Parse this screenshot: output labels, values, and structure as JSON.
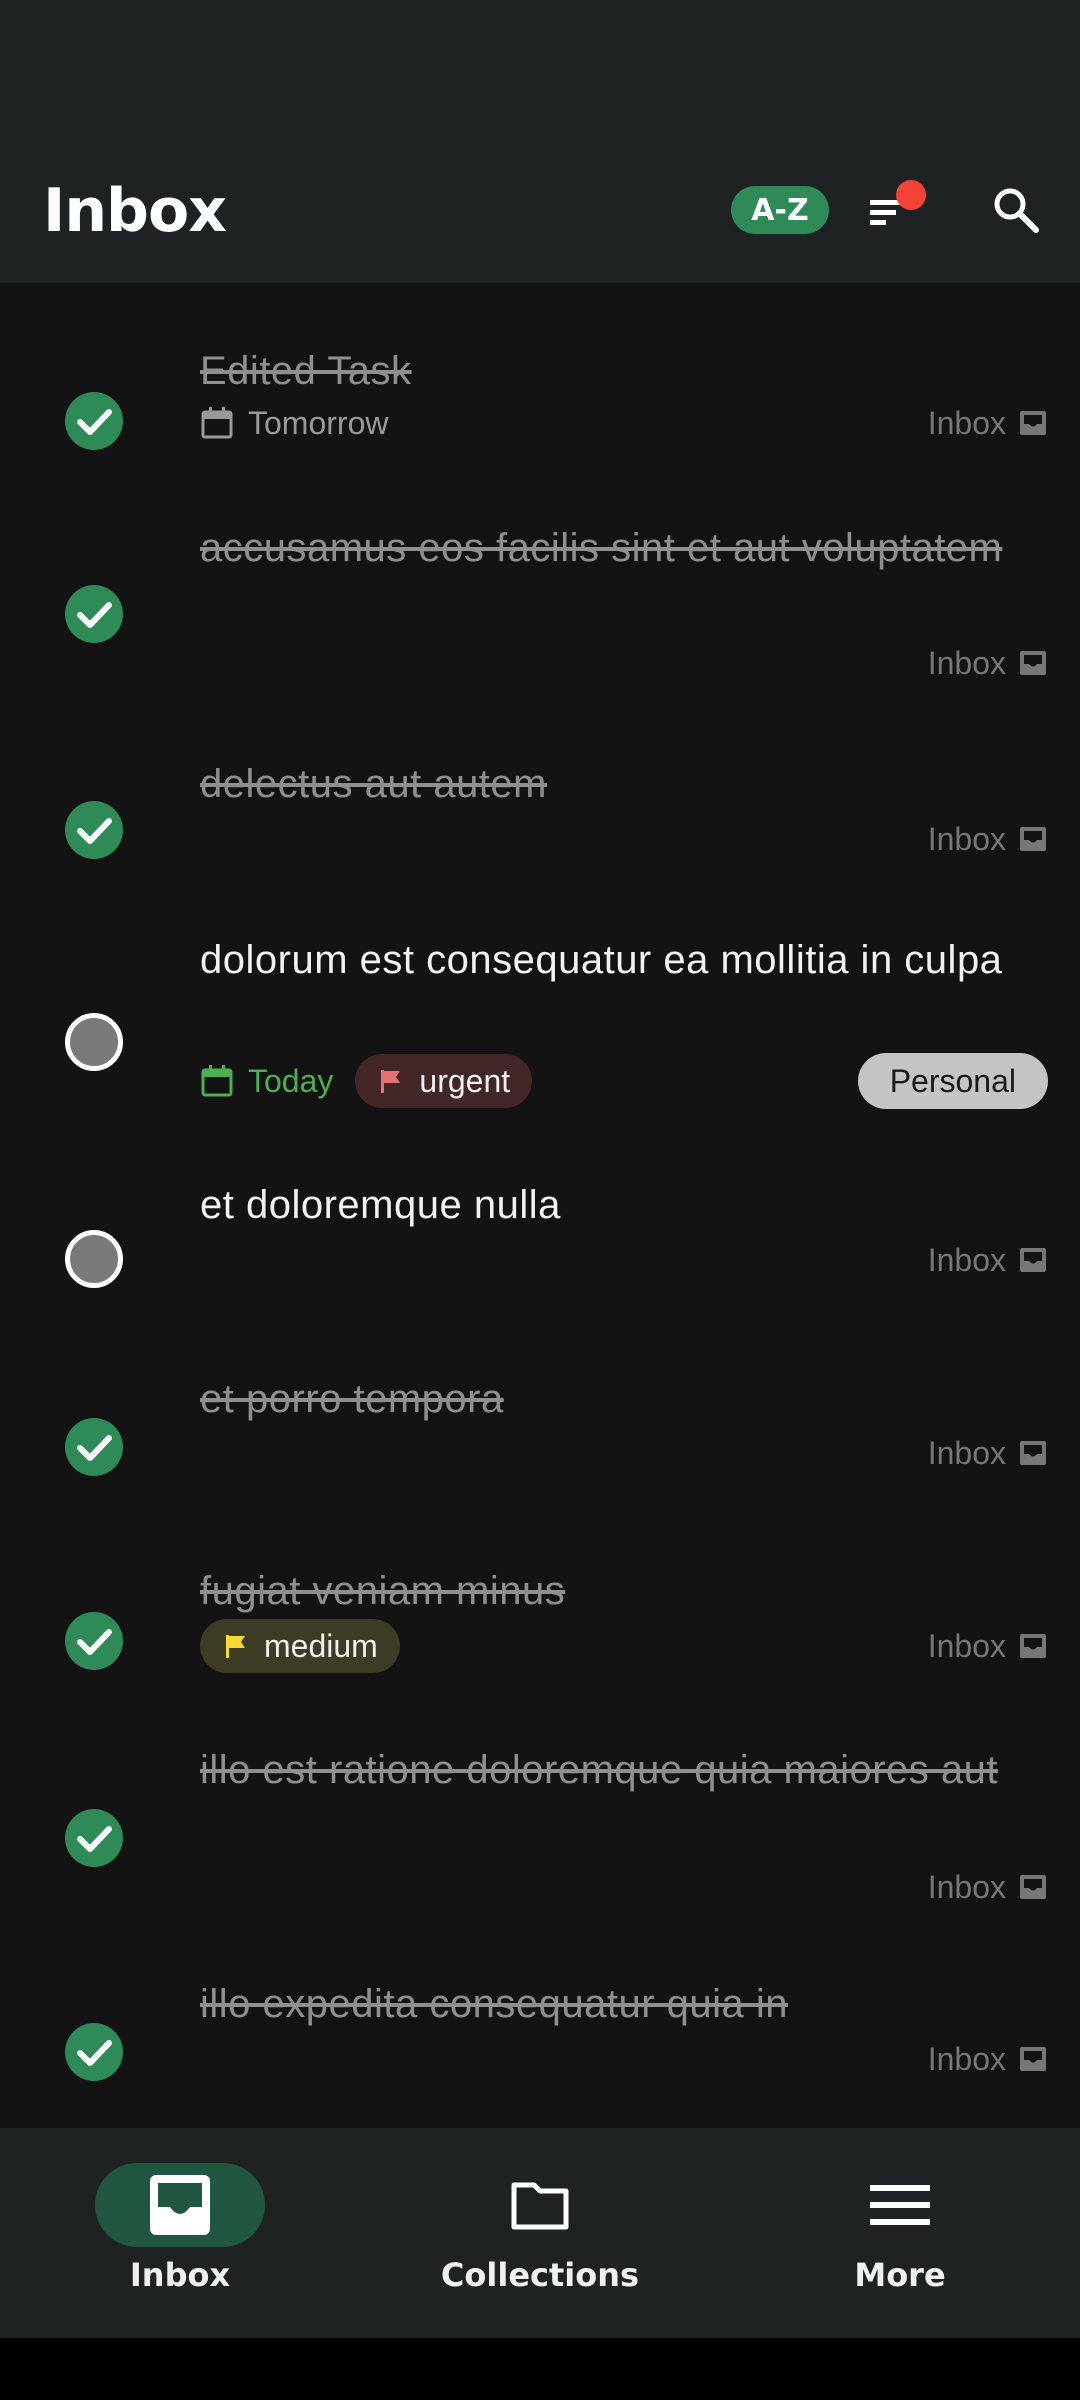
{
  "header": {
    "title": "Inbox",
    "sort_label": "A-Z",
    "filter_icon": "filter-lines-icon",
    "search_icon": "search-icon"
  },
  "tasks": [
    {
      "title": "Edited Task",
      "done": true,
      "date": "Tomorrow",
      "collection": "Inbox"
    },
    {
      "title": "accusamus eos facilis sint et aut voluptatem",
      "done": true,
      "collection": "Inbox"
    },
    {
      "title": "delectus aut autem",
      "done": true,
      "collection": "Inbox"
    },
    {
      "title": "dolorum est consequatur ea mollitia in culpa",
      "done": false,
      "date": "Today",
      "priority": "urgent",
      "collection": "Personal"
    },
    {
      "title": "et doloremque nulla",
      "done": false,
      "collection": "Inbox"
    },
    {
      "title": "et porro tempora",
      "done": true,
      "collection": "Inbox"
    },
    {
      "title": "fugiat veniam minus",
      "done": true,
      "priority": "medium",
      "collection": "Inbox"
    },
    {
      "title": "illo est ratione doloremque quia maiores aut",
      "done": true,
      "collection": "Inbox"
    },
    {
      "title": "illo expedita consequatur quia in",
      "done": true,
      "collection": "Inbox"
    }
  ],
  "nav": {
    "items": [
      {
        "label": "Inbox",
        "icon": "inbox-icon",
        "active": true
      },
      {
        "label": "Collections",
        "icon": "folder-icon",
        "active": false
      },
      {
        "label": "More",
        "icon": "menu-icon",
        "active": false
      }
    ]
  },
  "colors": {
    "accent": "#2e8b57",
    "urgent_flag": "#e57373",
    "medium_flag": "#fdd835",
    "today": "#4caf50"
  }
}
